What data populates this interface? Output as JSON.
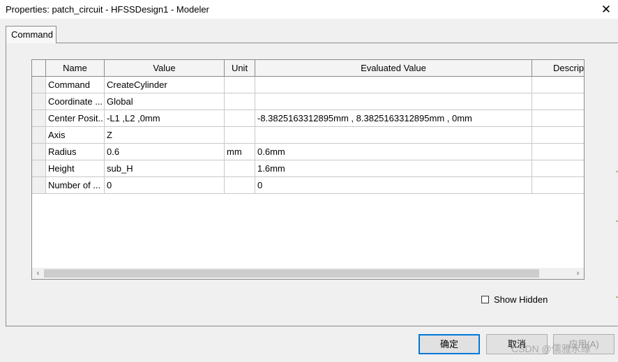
{
  "window": {
    "title": "Properties: patch_circuit - HFSSDesign1 - Modeler",
    "close_glyph": "✕"
  },
  "tabs": [
    {
      "label": "Command",
      "selected": true
    }
  ],
  "table": {
    "columns": [
      "",
      "Name",
      "Value",
      "Unit",
      "Evaluated Value",
      "Descript"
    ],
    "rows": [
      {
        "name": "Command",
        "value": "CreateCylinder",
        "unit": "",
        "evaluated": ""
      },
      {
        "name": "Coordinate ...",
        "value": "Global",
        "unit": "",
        "evaluated": ""
      },
      {
        "name": "Center Posit...",
        "value": "-L1 ,L2 ,0mm",
        "unit": "",
        "evaluated": "-8.3825163312895mm , 8.3825163312895mm , 0mm"
      },
      {
        "name": "Axis",
        "value": "Z",
        "unit": "",
        "evaluated": ""
      },
      {
        "name": "Radius",
        "value": "0.6",
        "unit": "mm",
        "evaluated": "0.6mm"
      },
      {
        "name": "Height",
        "value": "sub_H",
        "unit": "",
        "evaluated": "1.6mm"
      },
      {
        "name": "Number of ...",
        "value": "0",
        "unit": "",
        "evaluated": "0"
      }
    ]
  },
  "scrollbar": {
    "left_arrow": "‹",
    "right_arrow": "›"
  },
  "show_hidden": {
    "label": "Show Hidden",
    "checked": false
  },
  "buttons": {
    "ok": "确定",
    "cancel": "取消",
    "apply": "应用(A)"
  },
  "watermark": "CSDN @儒雅永缘",
  "colors": {
    "background": "#f0f0f0",
    "focus_border": "#0078d7",
    "grid_line": "#c8c8c8"
  }
}
